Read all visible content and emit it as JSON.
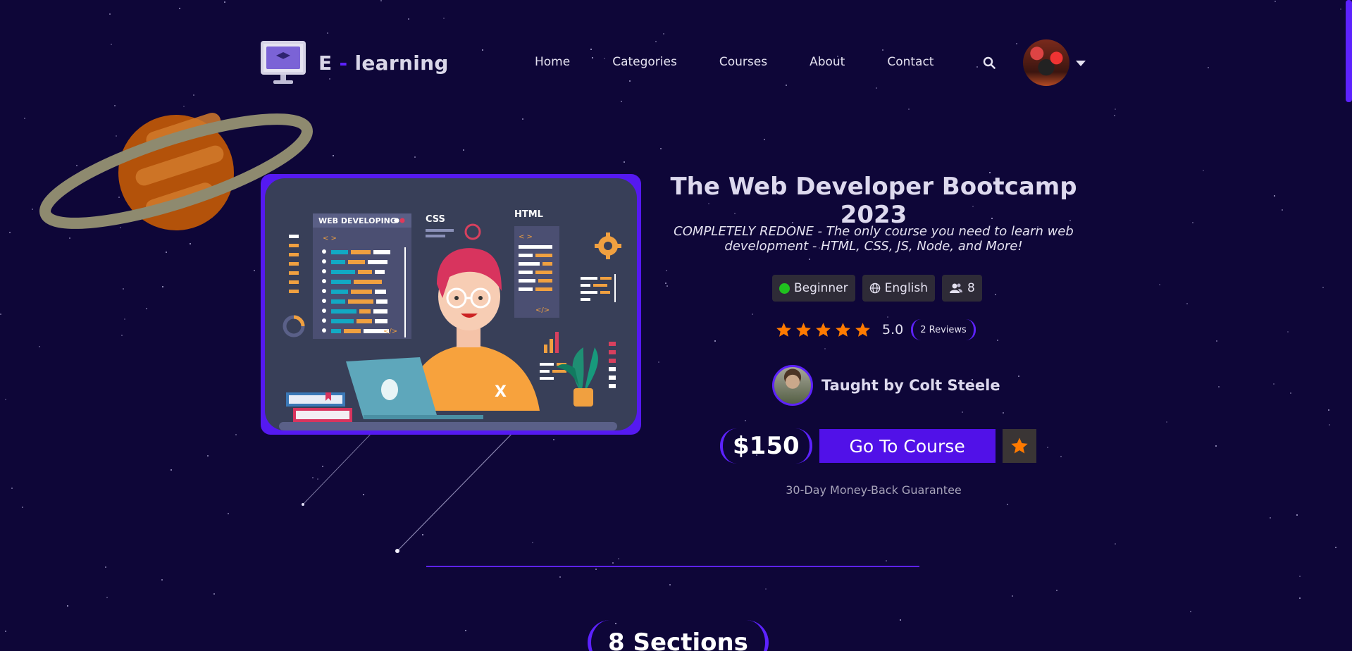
{
  "brand": {
    "name_part1": "E",
    "dash": "-",
    "name_part2": "learning"
  },
  "nav": {
    "items": [
      "Home",
      "Categories",
      "Courses",
      "About",
      "Contact"
    ]
  },
  "course": {
    "title": "The Web Developer Bootcamp 2023",
    "subtitle": "COMPLETELY REDONE - The only course you need to learn web development - HTML, CSS, JS, Node, and More!",
    "level": "Beginner",
    "language": "English",
    "students": "8",
    "rating": "5.0",
    "rating_value": 5,
    "reviews": "2 Reviews",
    "teacher": "Taught by Colt Steele",
    "price": "$150",
    "cta": "Go To Course",
    "guarantee": "30-Day Money-Back Guarantee"
  },
  "illustration": {
    "panel1": "WEB DEVELOPING",
    "panel2": "CSS",
    "panel3": "HTML",
    "code_tag": "</>",
    "bracket": "< >",
    "laptop_mark": "X"
  },
  "sections": {
    "label": "8 Sections"
  },
  "colors": {
    "background": "#0e0638",
    "accent": "#5d22ff",
    "button": "#5111e8",
    "star": "#ff7a00",
    "level_dot": "#20c11f"
  },
  "icons": {
    "search": "search-icon",
    "globe": "globe-icon",
    "users": "users-icon",
    "star": "star-icon",
    "caret": "caret-down-icon"
  }
}
